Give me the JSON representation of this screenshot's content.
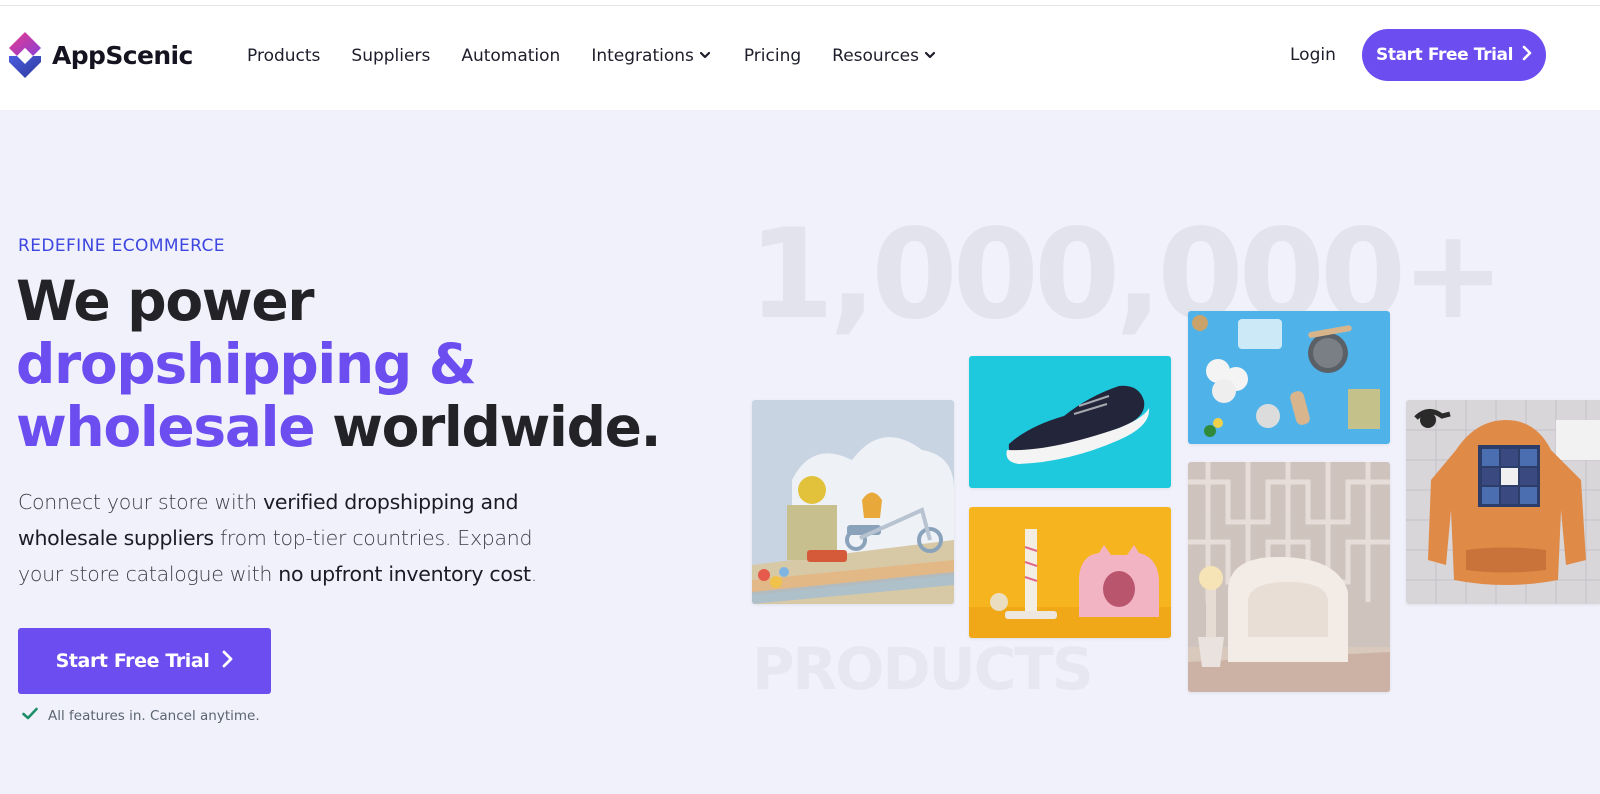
{
  "brand": {
    "name": "AppScenic",
    "colors": {
      "accent": "#6c4df0",
      "eyebrow": "#3d46e0",
      "check": "#1f8f6a",
      "background": "#f0f1fb"
    }
  },
  "nav": {
    "items": [
      {
        "label": "Products",
        "dropdown": false
      },
      {
        "label": "Suppliers",
        "dropdown": false
      },
      {
        "label": "Automation",
        "dropdown": false
      },
      {
        "label": "Integrations",
        "dropdown": true
      },
      {
        "label": "Pricing",
        "dropdown": false
      },
      {
        "label": "Resources",
        "dropdown": true
      }
    ],
    "login": "Login",
    "cta": "Start Free Trial"
  },
  "hero": {
    "eyebrow": "REDEFINE ECOMMERCE",
    "headline": {
      "line1": "We power",
      "highlight1": "dropshipping &",
      "highlight2": "wholesale",
      "rest": "worldwide."
    },
    "description": {
      "p1": "Connect your store with ",
      "b1": "verified dropshipping and wholesale suppliers",
      "p2": " from top-tier countries. Expand your store catalogue with ",
      "b2": "no upfront inventory cost",
      "p3": "."
    },
    "cta": "Start Free Trial",
    "note": "All features in. Cancel anytime."
  },
  "showcase": {
    "count": "1,000,000+",
    "word": "PRODUCTS",
    "tiles": [
      "kids-toys-image",
      "sneaker-image",
      "beauty-products-image",
      "pet-scratcher-image",
      "armchair-image",
      "hoodie-image"
    ]
  }
}
